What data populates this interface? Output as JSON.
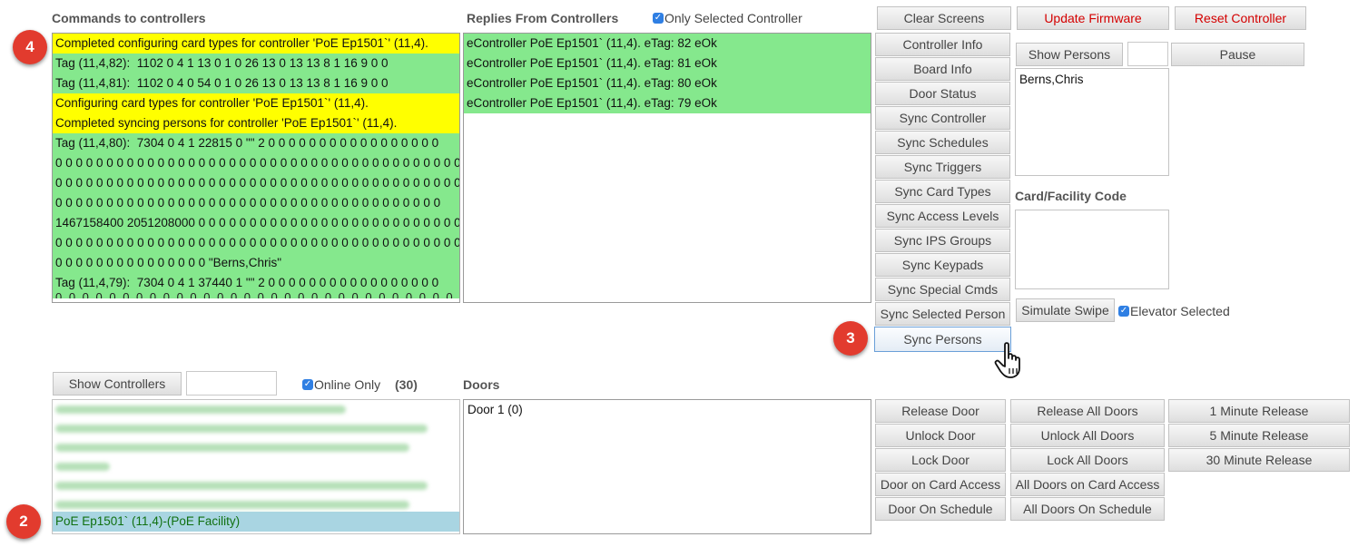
{
  "commands": {
    "title": "Commands to controllers",
    "lines": [
      {
        "text": "Completed configuring card types for controller 'PoE Ep1501`' (11,4).",
        "color": "#ffff00"
      },
      {
        "text": "Tag (11,4,82):  1102 0 4 1 13 0 1 0 26 13 0 13 13 8 1 16 9 0 0",
        "color": "#85e88d"
      },
      {
        "text": "Tag (11,4,81):  1102 0 4 0 54 0 1 0 26 13 0 13 13 8 1 16 9 0 0",
        "color": "#85e88d"
      },
      {
        "text": "Configuring card types for controller 'PoE Ep1501`' (11,4).",
        "color": "#ffff00"
      },
      {
        "text": "Completed syncing persons for controller 'PoE Ep1501`' (11,4).",
        "color": "#ffff00"
      },
      {
        "text": "Tag (11,4,80):  7304 0 4 1 22815 0 \"\" 2 0 0 0 0 0 0 0 0 0 0 0 0 0 0 0 0 0",
        "color": "#85e88d"
      },
      {
        "text": "0 0 0 0 0 0 0 0 0 0 0 0 0 0 0 0 0 0 0 0 0 0 0 0 0 0 0 0 0 0 0 0 0 0 0 0 0 0 0 0",
        "color": "#85e88d"
      },
      {
        "text": "0 0 0 0 0 0 0 0 0 0 0 0 0 0 0 0 0 0 0 0 0 0 0 0 0 0 0 0 0 0 0 0 0 0 0 0 0 0 0 0",
        "color": "#85e88d"
      },
      {
        "text": "0 0 0 0 0 0 0 0 0 0 0 0 0 0 0 0 0 0 0 0 0 0 0 0 0 0 0 0 0 0 0 0 0 0 0 0 0 0",
        "color": "#85e88d"
      },
      {
        "text": "1467158400 2051208000 0 0 0 0 0 0 0 0 0 0 0 0 0 0 0 0 0 0 0 0 0 0 0 0 0 0",
        "color": "#85e88d"
      },
      {
        "text": "0 0 0 0 0 0 0 0 0 0 0 0 0 0 0 0 0 0 0 0 0 0 0 0 0 0 0 0 0 0 0 0 0 0 0 0 0 0 0 0",
        "color": "#85e88d"
      },
      {
        "text": "0 0 0 0 0 0 0 0 0 0 0 0 0 0 0 \"Berns,Chris\"",
        "color": "#85e88d"
      },
      {
        "text": "Tag (11,4,79):  7304 0 4 1 37440 1 \"\" 2 0 0 0 0 0 0 0 0 0 0 0 0 0 0 0 0 0",
        "color": "#85e88d"
      }
    ]
  },
  "replies": {
    "title": "Replies From Controllers",
    "only_selected_label": "Only Selected Controller",
    "only_selected_checked": true,
    "lines": [
      "eController PoE Ep1501` (11,4). eTag: 82 eOk",
      "eController PoE Ep1501` (11,4). eTag: 81 eOk",
      "eController PoE Ep1501` (11,4). eTag: 80 eOk",
      "eController PoE Ep1501` (11,4). eTag: 79 eOk"
    ]
  },
  "top_buttons": {
    "clear_screens": "Clear Screens",
    "update_firmware": "Update Firmware",
    "reset_controller": "Reset Controller"
  },
  "controller_buttons": [
    "Controller Info",
    "Board Info",
    "Door Status",
    "Sync Controller",
    "Sync Schedules",
    "Sync Triggers",
    "Sync Card Types",
    "Sync Access Levels",
    "Sync IPS Groups",
    "Sync Keypads",
    "Sync Special Cmds",
    "Sync Selected Person",
    "Sync Persons"
  ],
  "persons": {
    "show_label": "Show Persons",
    "filter_value": "",
    "pause_label": "Pause",
    "items": [
      "Berns,Chris"
    ],
    "card_facility_title": "Card/Facility Code",
    "simulate_swipe_label": "Simulate Swipe",
    "elevator_label": "Elevator Selected",
    "elevator_checked": true
  },
  "controllers": {
    "show_label": "Show Controllers",
    "filter_value": "",
    "online_only_label": "Online Only",
    "online_only_checked": true,
    "count": "(30)",
    "selected_item": "PoE Ep1501` (11,4)-(PoE Facility)"
  },
  "doors": {
    "title": "Doors",
    "items": [
      "Door 1 (0)"
    ]
  },
  "door_buttons": {
    "col1": [
      "Release Door",
      "Unlock Door",
      "Lock Door",
      "Door on Card Access",
      "Door On Schedule"
    ],
    "col2": [
      "Release All Doors",
      "Unlock All Doors",
      "Lock All Doors",
      "All Doors on Card Access",
      "All Doors On Schedule"
    ],
    "col3": [
      "1 Minute Release",
      "5 Minute Release",
      "30 Minute Release"
    ]
  },
  "badges": {
    "b4": "4",
    "b3": "3",
    "b2": "2"
  },
  "check_glyph": "✓",
  "colors": {
    "highlight_yellow": "#ffff00",
    "success_green": "#85e88d",
    "selected_blue": "#a9d5e2",
    "badge_red": "#e23b2e",
    "danger_text": "#d40000"
  }
}
